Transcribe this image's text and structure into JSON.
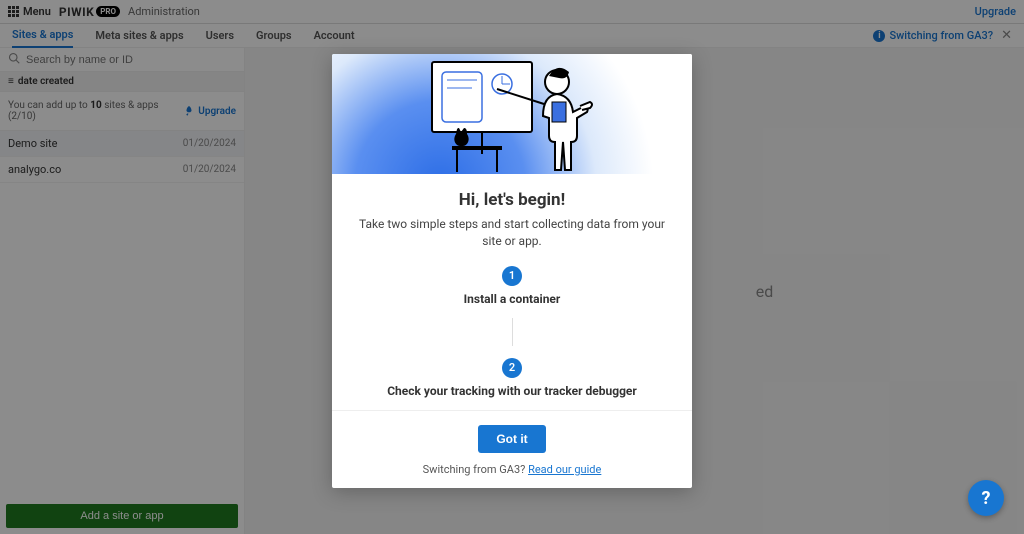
{
  "topbar": {
    "menu_label": "Menu",
    "brand_piwik": "PIWIK",
    "brand_pro": "PRO",
    "section": "Administration",
    "upgrade": "Upgrade"
  },
  "tabs": {
    "items": [
      {
        "label": "Sites & apps",
        "active": true
      },
      {
        "label": "Meta sites & apps",
        "active": false
      },
      {
        "label": "Users",
        "active": false
      },
      {
        "label": "Groups",
        "active": false
      },
      {
        "label": "Account",
        "active": false
      }
    ],
    "switching_label": "Switching from GA3?"
  },
  "sidebar": {
    "search_placeholder": "Search by name or ID",
    "sort_label": "date created",
    "limit_prefix": "You can add up to ",
    "limit_bold": "10",
    "limit_suffix": " sites & apps (2/10)",
    "upgrade_label": "Upgrade",
    "sites": [
      {
        "name": "Demo site",
        "date": "01/20/2024"
      },
      {
        "name": "analygo.co",
        "date": "01/20/2024"
      }
    ],
    "add_button": "Add a site or app"
  },
  "content": {
    "placeholder_right": "ed"
  },
  "modal": {
    "title": "Hi, let's begin!",
    "subtitle": "Take two simple steps and start collecting data from your site or app.",
    "step1_num": "1",
    "step1_label": "Install a container",
    "step2_num": "2",
    "step2_label": "Check your tracking with our tracker debugger",
    "gotit": "Got it",
    "footer_text": "Switching from GA3? ",
    "footer_link": "Read our guide"
  },
  "fab": {
    "label": "?"
  }
}
